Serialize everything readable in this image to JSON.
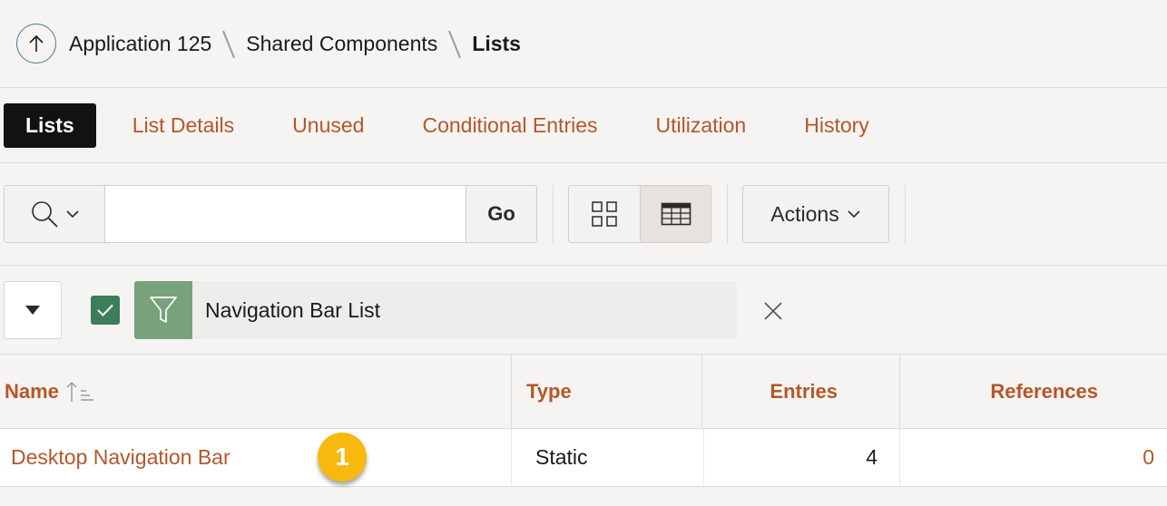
{
  "breadcrumb": {
    "items": [
      "Application 125",
      "Shared Components",
      "Lists"
    ]
  },
  "tabs": [
    {
      "label": "Lists",
      "active": true
    },
    {
      "label": "List Details",
      "active": false
    },
    {
      "label": "Unused",
      "active": false
    },
    {
      "label": "Conditional Entries",
      "active": false
    },
    {
      "label": "Utilization",
      "active": false
    },
    {
      "label": "History",
      "active": false
    }
  ],
  "toolbar": {
    "search_value": "",
    "go_label": "Go",
    "actions_label": "Actions",
    "view_active": "report"
  },
  "filter": {
    "label": "Navigation Bar List",
    "enabled": true
  },
  "table": {
    "headers": [
      "Name",
      "Type",
      "Entries",
      "References"
    ],
    "sort": {
      "column": "Name",
      "direction": "ascending"
    },
    "rows": [
      {
        "name": "Desktop Navigation Bar",
        "type": "Static",
        "entries": "4",
        "references": "0"
      }
    ]
  },
  "callout": {
    "number": "1"
  },
  "colors": {
    "accent": "#b5562a",
    "tab_active_bg": "#121212",
    "filter_green": "#77a27a",
    "check_green": "#3d7d5a",
    "badge_yellow": "#f7b90e"
  }
}
